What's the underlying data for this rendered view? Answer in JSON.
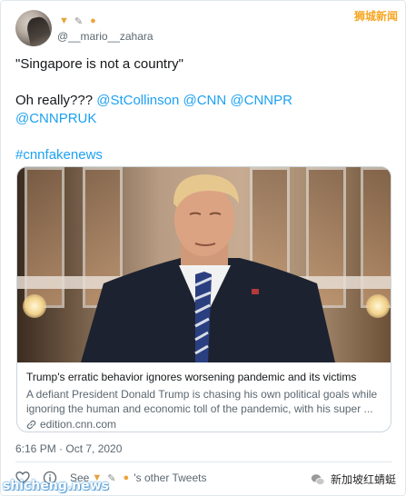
{
  "watermarks": {
    "top_right": "狮城新闻",
    "bottom_left": "shicheng.news",
    "bottom_right": "新加坡红蜻蜓"
  },
  "author": {
    "handle": "@__mario__zahara",
    "name_emojis": [
      "taco-emoji",
      "pencil-emoji",
      "bread-emoji"
    ]
  },
  "tweet": {
    "line1": "\"Singapore is not a country\"",
    "line2_prefix": "Oh really??? ",
    "mentions_line2": [
      "@StCollinson",
      "@CNN",
      "@CNNPR"
    ],
    "mention_line3": "@CNNPRUK",
    "hashtag": "#cnnfakenews"
  },
  "card": {
    "title": "Trump's erratic behavior ignores worsening pandemic and its victims",
    "description_lines": [
      "A defiant President Donald Trump is chasing his own political goals while",
      "ignoring the human and economic toll of the pandemic, with his super ..."
    ],
    "domain": "edition.cnn.com"
  },
  "timestamp": "6:16 PM · Oct 7, 2020",
  "actions": {
    "see_prefix": "See",
    "see_suffix": "'s other Tweets"
  },
  "colors": {
    "link": "#1da1f2",
    "secondary_text": "#5b6770",
    "border": "#e1e8ed"
  }
}
